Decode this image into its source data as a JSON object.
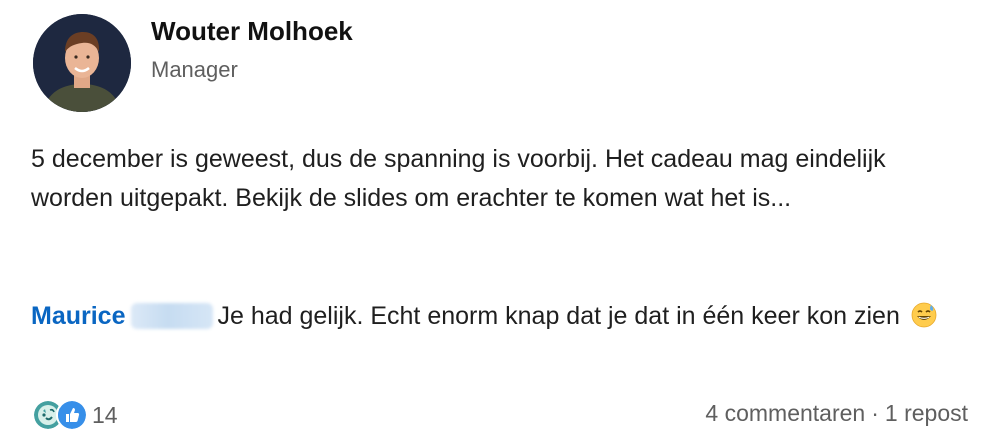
{
  "author": {
    "name": "Wouter Molhoek",
    "role": "Manager"
  },
  "post": {
    "text": "5 december is geweest, dus de spanning is voorbij. Het cadeau mag eindelijk worden uitgepakt. Bekijk de slides om erachter te komen wat het is..."
  },
  "reply": {
    "mention": "Maurice",
    "text": "Je had gelijk. Echt enorm knap dat je dat in één keer kon zien",
    "emoji": "grinning-sweat-emoji"
  },
  "footer": {
    "reaction_icons": [
      "celebrate-icon",
      "like-icon"
    ],
    "reaction_count": "14",
    "comments": "4 commentaren",
    "separator": "·",
    "reposts": "1 repost"
  },
  "colors": {
    "mention": "#0a66c2",
    "secondary_text": "#5f5f5f",
    "celebrate": "#44a0a0",
    "like": "#378fe9"
  }
}
